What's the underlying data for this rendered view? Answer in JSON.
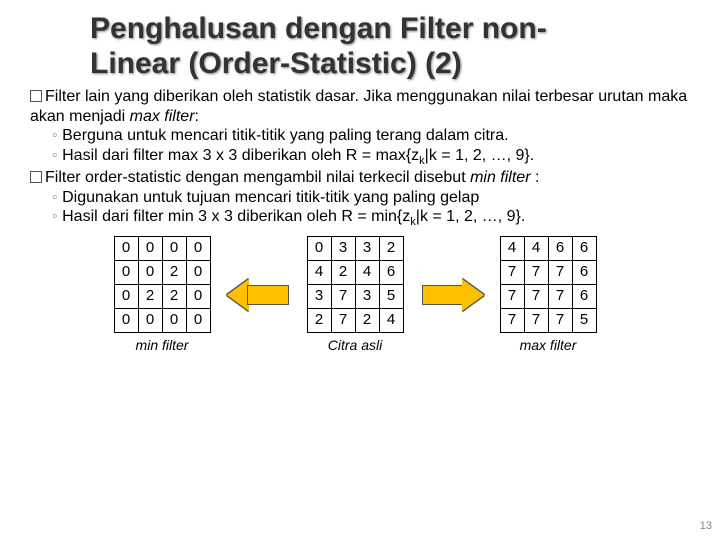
{
  "title_line1": "Penghalusan dengan Filter non-",
  "title_line2": "Linear (Order-Statistic) (2)",
  "para1_pre": "Filter lain yang diberikan oleh statistik dasar. Jika menggunakan nilai terbesar urutan maka akan menjadi ",
  "para1_em": "max filter",
  "para1_post": ":",
  "bullet1a": "Berguna untuk mencari titik-titik yang paling terang dalam citra.",
  "bullet1b_pre": "Hasil dari filter max 3 x 3 diberikan oleh R = max{z",
  "bullet1b_sub": "k",
  "bullet1b_post": "|k = 1, 2, …, 9}.",
  "para2_pre": "Filter order-statistic dengan mengambil nilai terkecil disebut ",
  "para2_em": "min filter",
  "para2_post": " :",
  "bullet2a": "Digunakan untuk tujuan mencari titik-titik yang paling gelap",
  "bullet2b_pre": "Hasil dari filter min 3 x 3 diberikan oleh R = min{z",
  "bullet2b_sub": "k",
  "bullet2b_post": "|k = 1, 2, …, 9}.",
  "tables": {
    "min": {
      "caption": "min filter",
      "rows": [
        [
          "0",
          "0",
          "0",
          "0"
        ],
        [
          "0",
          "0",
          "2",
          "0"
        ],
        [
          "0",
          "2",
          "2",
          "0"
        ],
        [
          "0",
          "0",
          "0",
          "0"
        ]
      ]
    },
    "src": {
      "caption": "Citra asli",
      "rows": [
        [
          "0",
          "3",
          "3",
          "2"
        ],
        [
          "4",
          "2",
          "4",
          "6"
        ],
        [
          "3",
          "7",
          "3",
          "5"
        ],
        [
          "2",
          "7",
          "2",
          "4"
        ]
      ]
    },
    "max": {
      "caption": "max filter",
      "rows": [
        [
          "4",
          "4",
          "6",
          "6"
        ],
        [
          "7",
          "7",
          "7",
          "6"
        ],
        [
          "7",
          "7",
          "7",
          "6"
        ],
        [
          "7",
          "7",
          "7",
          "5"
        ]
      ]
    }
  },
  "page_number": "13",
  "chart_data": [
    {
      "type": "table",
      "title": "min filter",
      "rows": [
        [
          0,
          0,
          0,
          0
        ],
        [
          0,
          0,
          2,
          0
        ],
        [
          0,
          2,
          2,
          0
        ],
        [
          0,
          0,
          0,
          0
        ]
      ]
    },
    {
      "type": "table",
      "title": "Citra asli",
      "rows": [
        [
          0,
          3,
          3,
          2
        ],
        [
          4,
          2,
          4,
          6
        ],
        [
          3,
          7,
          3,
          5
        ],
        [
          2,
          7,
          2,
          4
        ]
      ]
    },
    {
      "type": "table",
      "title": "max filter",
      "rows": [
        [
          4,
          4,
          6,
          6
        ],
        [
          7,
          7,
          7,
          6
        ],
        [
          7,
          7,
          7,
          6
        ],
        [
          7,
          7,
          7,
          5
        ]
      ]
    }
  ]
}
